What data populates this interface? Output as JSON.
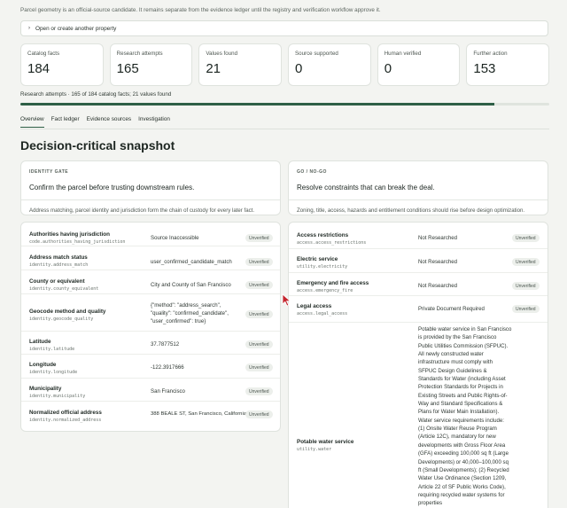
{
  "notice": "Parcel geometry is an official-source candidate. It remains separate from the evidence ledger until the registry and verification workflow approve it.",
  "open_property": {
    "label": "Open or create another property",
    "icon": "chevron-right-icon"
  },
  "stats": [
    {
      "label": "Catalog facts",
      "value": "184"
    },
    {
      "label": "Research attempts",
      "value": "165"
    },
    {
      "label": "Values found",
      "value": "21"
    },
    {
      "label": "Source supported",
      "value": "0"
    },
    {
      "label": "Human verified",
      "value": "0"
    },
    {
      "label": "Further action",
      "value": "153"
    }
  ],
  "progress": {
    "label": "Research attempts · 165 of 184 catalog facts; 21 values found",
    "fraction": 0.8967,
    "color": "#2e5f46"
  },
  "tabs": [
    "Overview",
    "Fact ledger",
    "Evidence sources",
    "Investigation"
  ],
  "active_tab": "Overview",
  "snapshot_title": "Decision-critical snapshot",
  "gates": {
    "identity": {
      "eyebrow": "IDENTITY GATE",
      "heading": "Confirm the parcel before trusting downstream rules.",
      "description": "Address matching, parcel identity and jurisdiction form the chain of custody for every later fact."
    },
    "go_no_go": {
      "eyebrow": "GO / NO-GO",
      "heading": "Resolve constraints that can break the deal.",
      "description": "Zoning, title, access, hazards and entitlement conditions should rise before design optimization."
    }
  },
  "identity_rows": [
    {
      "label": "Authorities having jurisdiction",
      "key": "code.authorities_having_jurisdiction",
      "value": "Source Inaccessible",
      "badge": "Unverified"
    },
    {
      "label": "Address match status",
      "key": "identity.address_match",
      "value": "user_confirmed_candidate_match",
      "badge": "Unverified"
    },
    {
      "label": "County or equivalent",
      "key": "identity.county_equivalent",
      "value": "City and County of San Francisco",
      "badge": "Unverified"
    },
    {
      "label": "Geocode method and quality",
      "key": "identity.geocode_quality",
      "value": "{\"method\": \"address_search\", \"quality\": \"confirmed_candidate\", \"user_confirmed\": true}",
      "badge": "Unverified"
    },
    {
      "label": "Latitude",
      "key": "identity.latitude",
      "value": "37.7877512",
      "badge": "Unverified"
    },
    {
      "label": "Longitude",
      "key": "identity.longitude",
      "value": "-122.3917666",
      "badge": "Unverified"
    },
    {
      "label": "Municipality",
      "key": "identity.municipality",
      "value": "San Francisco",
      "badge": "Unverified"
    },
    {
      "label": "Normalized official address",
      "key": "identity.normalized_address",
      "value": "388 BEALE ST, San Francisco, California",
      "badge": "Unverified"
    }
  ],
  "constraint_rows": [
    {
      "label": "Access restrictions",
      "key": "access.access_restrictions",
      "value": "Not Researched",
      "badge": "Unverified"
    },
    {
      "label": "Electric service",
      "key": "utility.electricity",
      "value": "Not Researched",
      "badge": "Unverified"
    },
    {
      "label": "Emergency and fire access",
      "key": "access.emergency_fire",
      "value": "Not Researched",
      "badge": "Unverified"
    },
    {
      "label": "Legal access",
      "key": "access.legal_access",
      "value": "Private Document Required",
      "badge": "Unverified"
    },
    {
      "label": "Potable water service",
      "key": "utility.water",
      "value": "Potable water service in San Francisco is provided by the San Francisco Public Utilities Commission (SFPUC). All newly constructed water infrastructure must comply with SFPUC Design Guidelines & Standards for Water (including Asset Protection Standards for Projects in Existing Streets and Public Rights-of-Way and Standard Specifications & Plans for Water Main Installation). Water service requirements include: (1) Onsite Water Reuse Program (Article 12C), mandatory for new developments with Gross Floor Area (GFA) exceeding 100,000 sq ft (Large Developments) or 40,000–100,000 sq ft (Small Developments); (2) Recycled Water Use Ordinance (Section 1209, Article 22 of SF Public Works Code), requiring recycled water systems for properties",
      "badge": ""
    }
  ]
}
